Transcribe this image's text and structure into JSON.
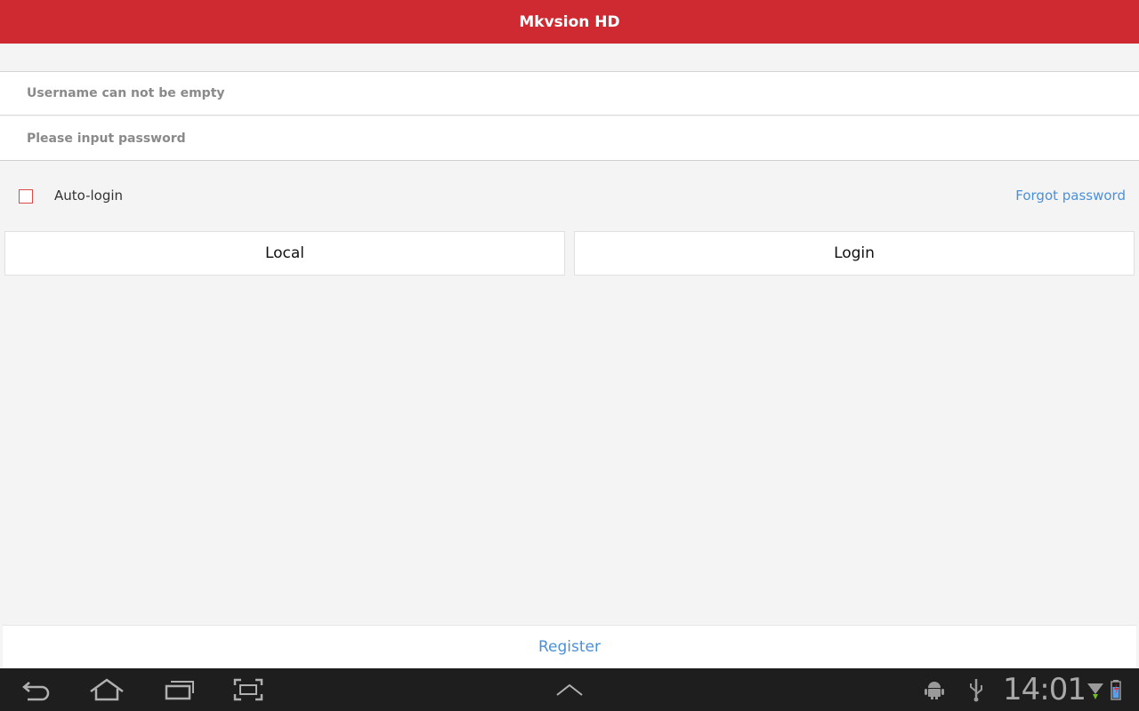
{
  "app": {
    "title": "Mkvsion HD"
  },
  "login_form": {
    "username_placeholder": "Username can not be empty",
    "password_placeholder": "Please input password",
    "username_value": "",
    "password_value": "",
    "auto_login_label": "Auto-login",
    "auto_login_checked": false,
    "forgot_password_label": "Forgot password",
    "local_button_label": "Local",
    "login_button_label": "Login"
  },
  "footer": {
    "register_label": "Register"
  },
  "system_bar": {
    "clock": "14:01",
    "icons": [
      "back-icon",
      "home-icon",
      "recent-apps-icon",
      "screenshot-icon",
      "chevron-up-icon",
      "android-debug-icon",
      "usb-icon",
      "wifi-icon",
      "battery-icon"
    ]
  },
  "colors": {
    "accent": "#cf2a32",
    "link": "#4a90d9",
    "background": "#f4f4f4"
  }
}
